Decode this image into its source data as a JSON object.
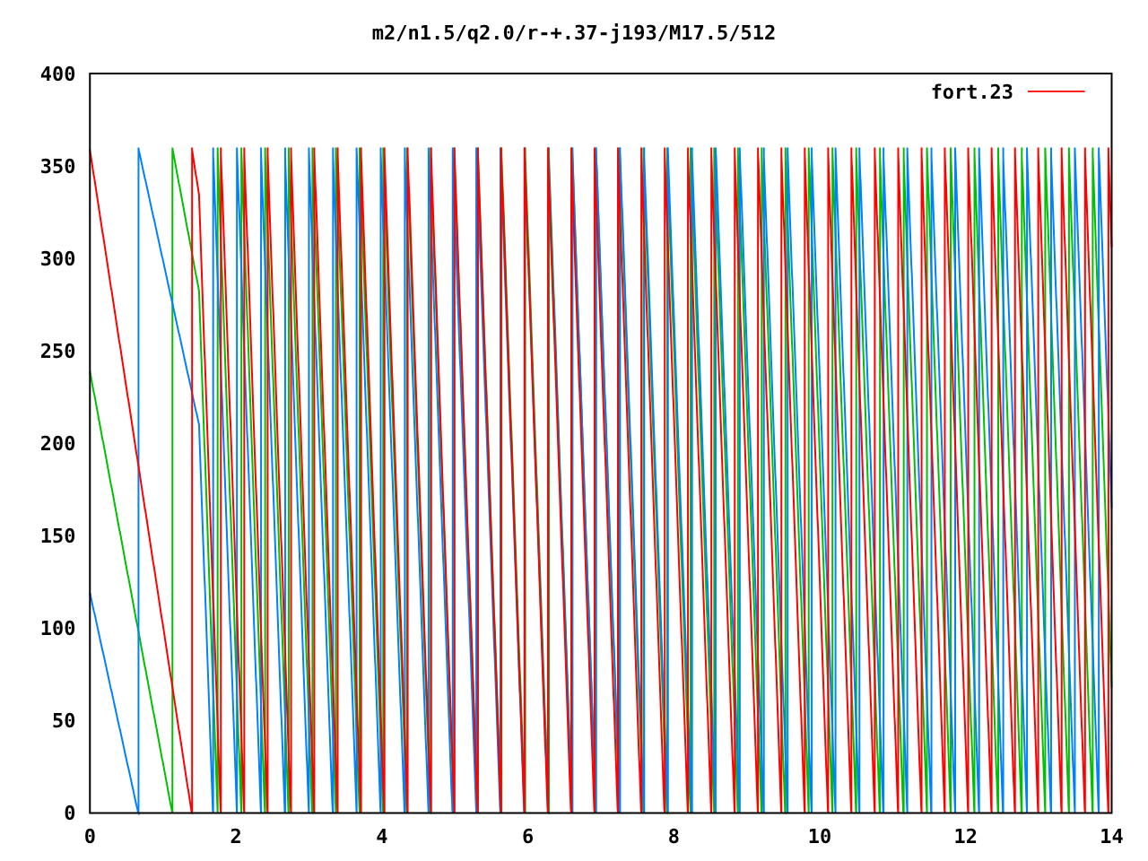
{
  "title": "m2/n1.5/q2.0/r-+.37-j193/M17.5/512",
  "y_ticks": [
    "400",
    "350",
    "300",
    "250",
    "200",
    "150",
    "100",
    "50",
    "0"
  ],
  "x_ticks": [
    "0",
    "2",
    "4",
    "6",
    "8",
    "10",
    "12",
    "14"
  ],
  "legend": {
    "label": "fort.23"
  }
}
